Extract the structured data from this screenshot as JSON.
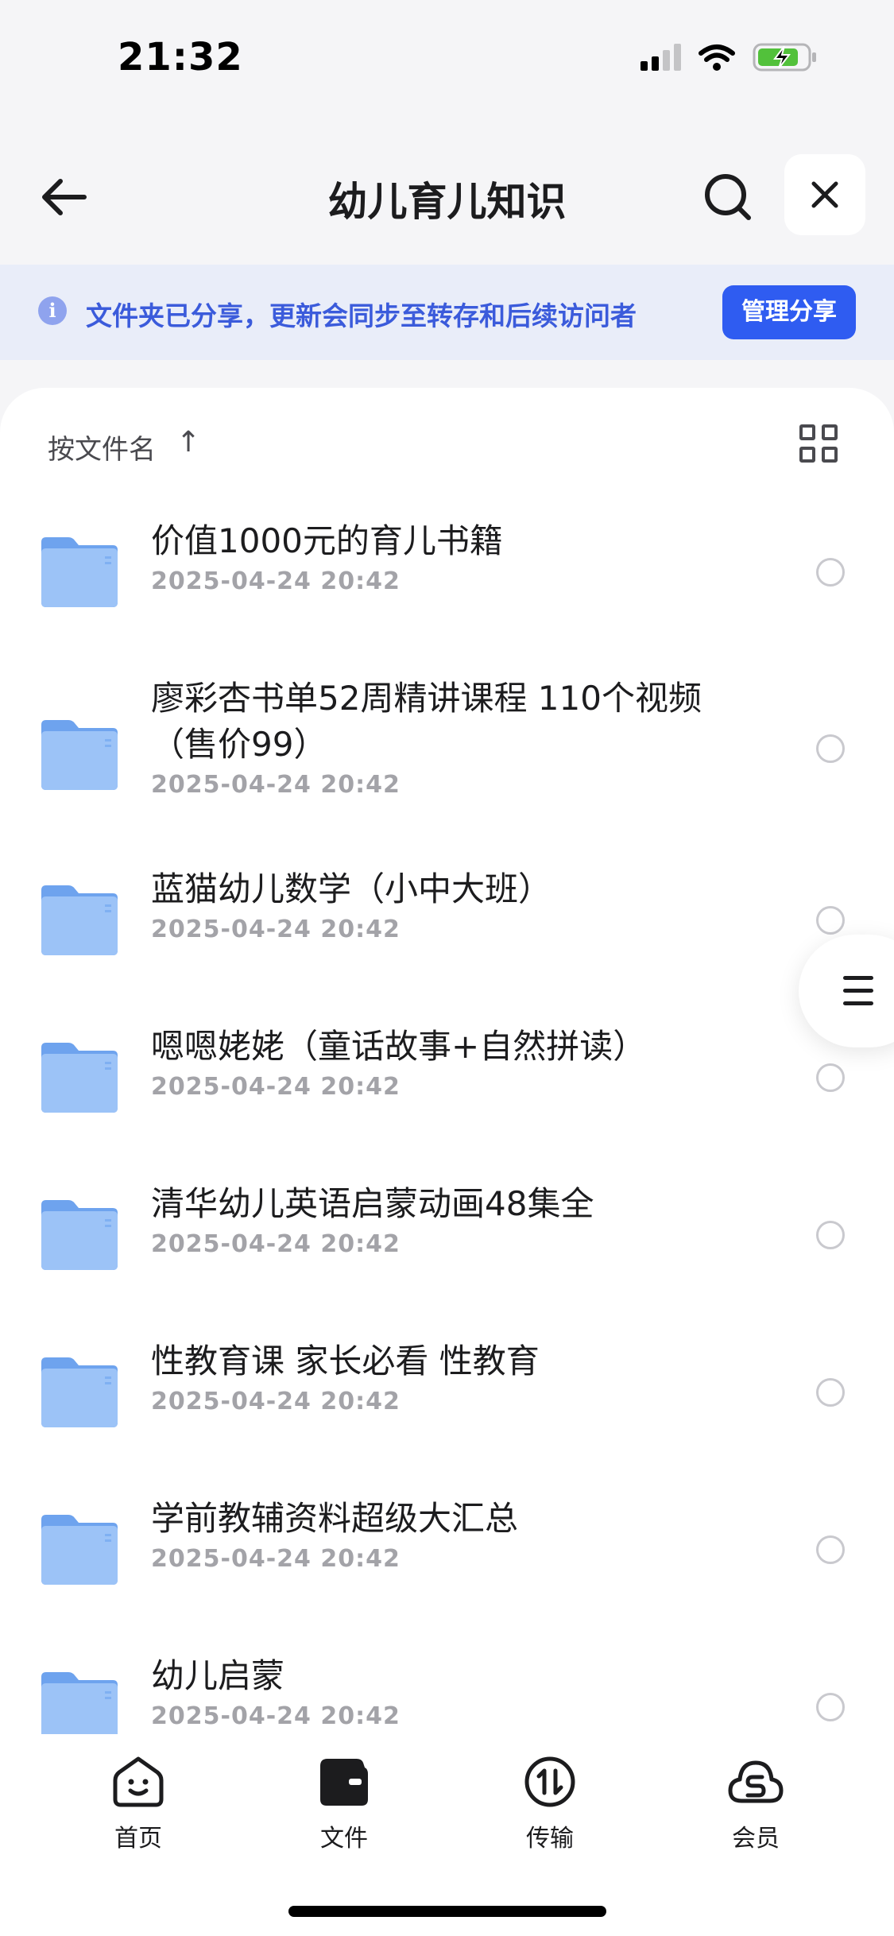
{
  "status_bar": {
    "time": "21:32",
    "icons": [
      "cellular-signal-icon",
      "wifi-icon",
      "battery-charging-icon"
    ]
  },
  "nav": {
    "title": "幼儿育儿知识",
    "icons": [
      "back-arrow-icon",
      "search-icon",
      "close-icon"
    ]
  },
  "share_banner": {
    "text": "文件夹已分享，更新会同步至转存和后续访问者",
    "button_label": "管理分享",
    "icon": "info-icon"
  },
  "sort": {
    "label": "按文件名",
    "direction_icon": "arrow-up-icon",
    "view_icon": "grid-view-icon"
  },
  "files": [
    {
      "name": "价值1000元的育儿书籍",
      "date": "2025-04-24 20:42"
    },
    {
      "name": "廖彩杏书单52周精讲课程  110个视频（售价99）",
      "date": "2025-04-24 20:42"
    },
    {
      "name": "蓝猫幼儿数学（小中大班）",
      "date": "2025-04-24 20:42"
    },
    {
      "name": "嗯嗯姥姥（童话故事+自然拼读）",
      "date": "2025-04-24 20:42"
    },
    {
      "name": "清华幼儿英语启蒙动画48集全",
      "date": "2025-04-24 20:42"
    },
    {
      "name": "性教育课 家长必看 性教育",
      "date": "2025-04-24 20:42"
    },
    {
      "name": "学前教辅资料超级大汇总",
      "date": "2025-04-24 20:42"
    },
    {
      "name": "幼儿启蒙",
      "date": "2025-04-24 20:42"
    }
  ],
  "tabs": [
    {
      "label": "首页",
      "icon": "home-face-icon"
    },
    {
      "label": "文件",
      "icon": "files-folder-icon"
    },
    {
      "label": "传输",
      "icon": "transfer-icon"
    },
    {
      "label": "会员",
      "icon": "vip-cloud-icon"
    }
  ],
  "colors": {
    "accent": "#2f5cf1",
    "banner_bg": "#e9edf9",
    "banner_text": "#3b5bdb",
    "folder": "#73a8f0"
  }
}
